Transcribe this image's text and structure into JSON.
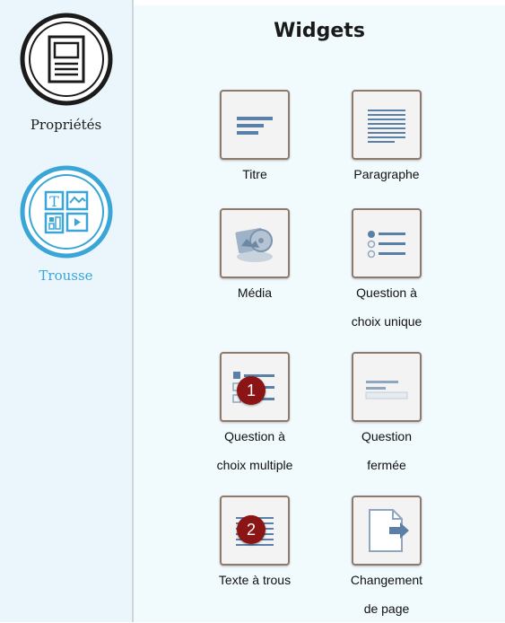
{
  "sidebar": {
    "items": [
      {
        "label": "Propriétés",
        "icon": "properties-icon",
        "active": false,
        "color": "#1b1b1b"
      },
      {
        "label": "Trousse",
        "icon": "toolkit-icon",
        "active": true,
        "color": "#3aa6d8"
      }
    ]
  },
  "main": {
    "title": "Widgets",
    "widgets": [
      {
        "label": "Titre",
        "icon": "title-icon"
      },
      {
        "label": "Paragraphe",
        "icon": "paragraph-icon"
      },
      {
        "label_line1": "Média",
        "icon": "media-icon"
      },
      {
        "label_line1": "Question à",
        "label_line2": "choix unique",
        "icon": "single-choice-icon"
      },
      {
        "label_line1": "Question à",
        "label_line2": "choix multiple",
        "icon": "multiple-choice-icon",
        "badge": "1"
      },
      {
        "label_line1": "Question",
        "label_line2": "fermée",
        "icon": "closed-question-icon"
      },
      {
        "label_line1": "Texte à trous",
        "icon": "fill-blanks-icon",
        "badge": "2"
      },
      {
        "label_line1": "Changement",
        "label_line2": "de page",
        "icon": "page-change-icon"
      }
    ]
  },
  "colors": {
    "badge": "#8b1414",
    "accent": "#3aa6d8",
    "tile_border": "#8e7a6c",
    "sidebar_bg": "#eaf6fb",
    "main_bg": "#f1fafd"
  }
}
